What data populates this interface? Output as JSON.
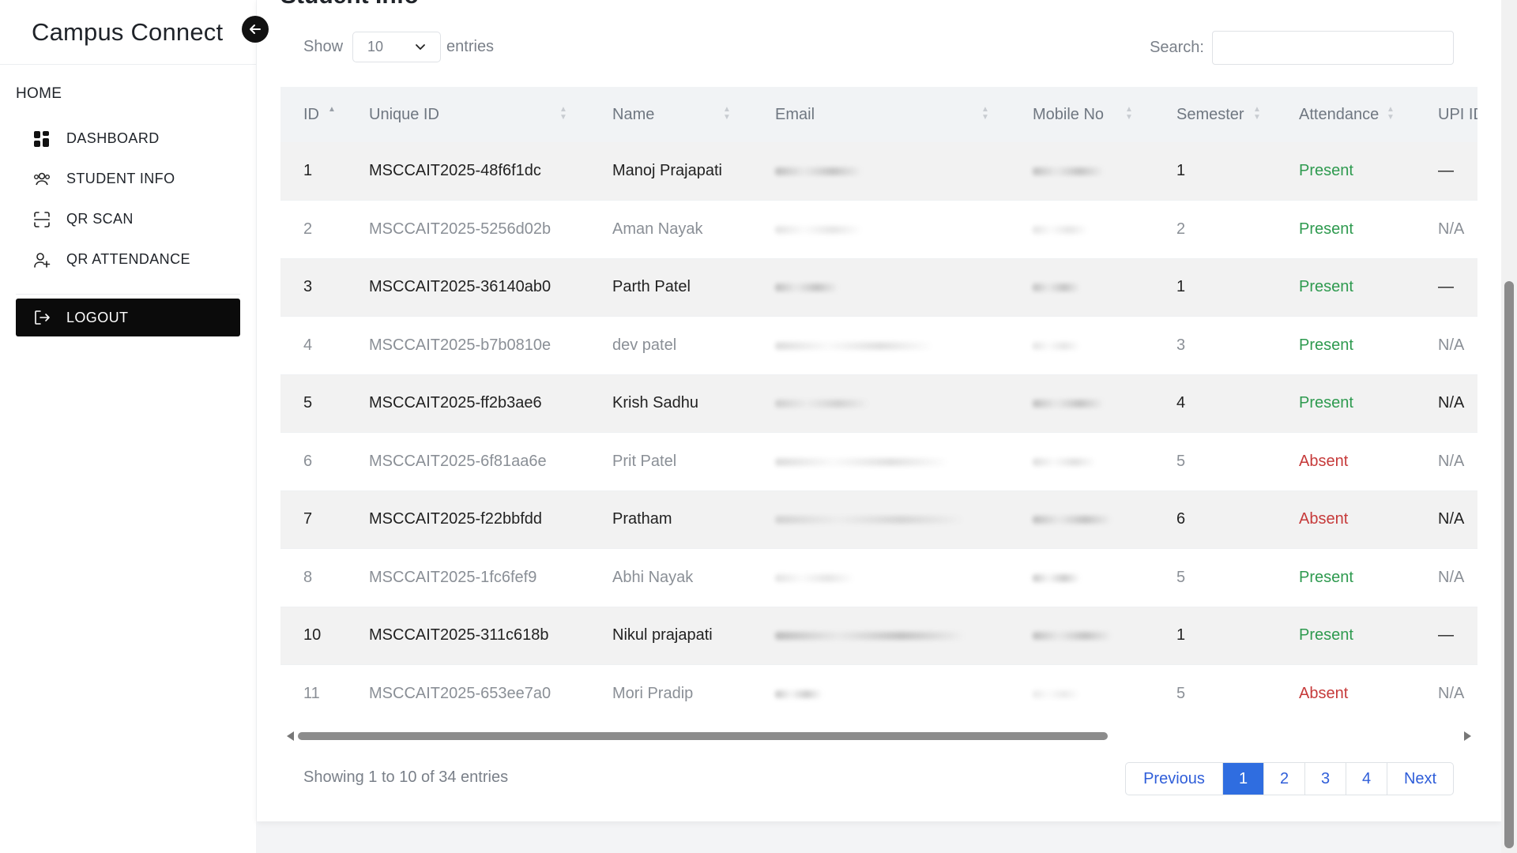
{
  "sidebar": {
    "brand": "Campus Connect",
    "section": "HOME",
    "items": [
      {
        "label": "DASHBOARD",
        "icon": "dashboard-grid-icon"
      },
      {
        "label": "STUDENT INFO",
        "icon": "users-icon"
      },
      {
        "label": "QR SCAN",
        "icon": "qr-scan-icon"
      },
      {
        "label": "QR ATTENDANCE",
        "icon": "user-plus-icon"
      }
    ],
    "logout": "LOGOUT"
  },
  "main": {
    "heading": "Student Info",
    "show_label": "Show",
    "entries_value": "10",
    "entries_label": "entries",
    "search_label": "Search:",
    "search_value": ""
  },
  "table": {
    "columns": [
      "ID",
      "Unique ID",
      "Name",
      "Email",
      "Mobile No",
      "Semester",
      "Attendance",
      "UPI ID"
    ],
    "rows": [
      {
        "id": "1",
        "uid": "MSCCAIT2025-48f6f1dc",
        "name": "Manoj Prajapati",
        "sem": "1",
        "att": "Present",
        "upi": "—"
      },
      {
        "id": "2",
        "uid": "MSCCAIT2025-5256d02b",
        "name": "Aman Nayak",
        "sem": "2",
        "att": "Present",
        "upi": "N/A"
      },
      {
        "id": "3",
        "uid": "MSCCAIT2025-36140ab0",
        "name": "Parth Patel",
        "sem": "1",
        "att": "Present",
        "upi": "—"
      },
      {
        "id": "4",
        "uid": "MSCCAIT2025-b7b0810e",
        "name": "dev patel",
        "sem": "3",
        "att": "Present",
        "upi": "N/A"
      },
      {
        "id": "5",
        "uid": "MSCCAIT2025-ff2b3ae6",
        "name": "Krish Sadhu",
        "sem": "4",
        "att": "Present",
        "upi": "N/A"
      },
      {
        "id": "6",
        "uid": "MSCCAIT2025-6f81aa6e",
        "name": "Prit Patel",
        "sem": "5",
        "att": "Absent",
        "upi": "N/A"
      },
      {
        "id": "7",
        "uid": "MSCCAIT2025-f22bbfdd",
        "name": "Pratham",
        "sem": "6",
        "att": "Absent",
        "upi": "N/A"
      },
      {
        "id": "8",
        "uid": "MSCCAIT2025-1fc6fef9",
        "name": "Abhi Nayak",
        "sem": "5",
        "att": "Present",
        "upi": "N/A"
      },
      {
        "id": "10",
        "uid": "MSCCAIT2025-311c618b",
        "name": "Nikul prajapati",
        "sem": "1",
        "att": "Present",
        "upi": "—"
      },
      {
        "id": "11",
        "uid": "MSCCAIT2025-653ee7a0",
        "name": "Mori Pradip",
        "sem": "5",
        "att": "Absent",
        "upi": "N/A"
      }
    ]
  },
  "footer": {
    "info": "Showing 1 to 10 of 34 entries",
    "previous": "Previous",
    "pages": [
      "1",
      "2",
      "3",
      "4"
    ],
    "next": "Next"
  },
  "colors": {
    "present": "#2e9a4f",
    "absent": "#c63a3a",
    "active_page": "#2f6de0"
  }
}
